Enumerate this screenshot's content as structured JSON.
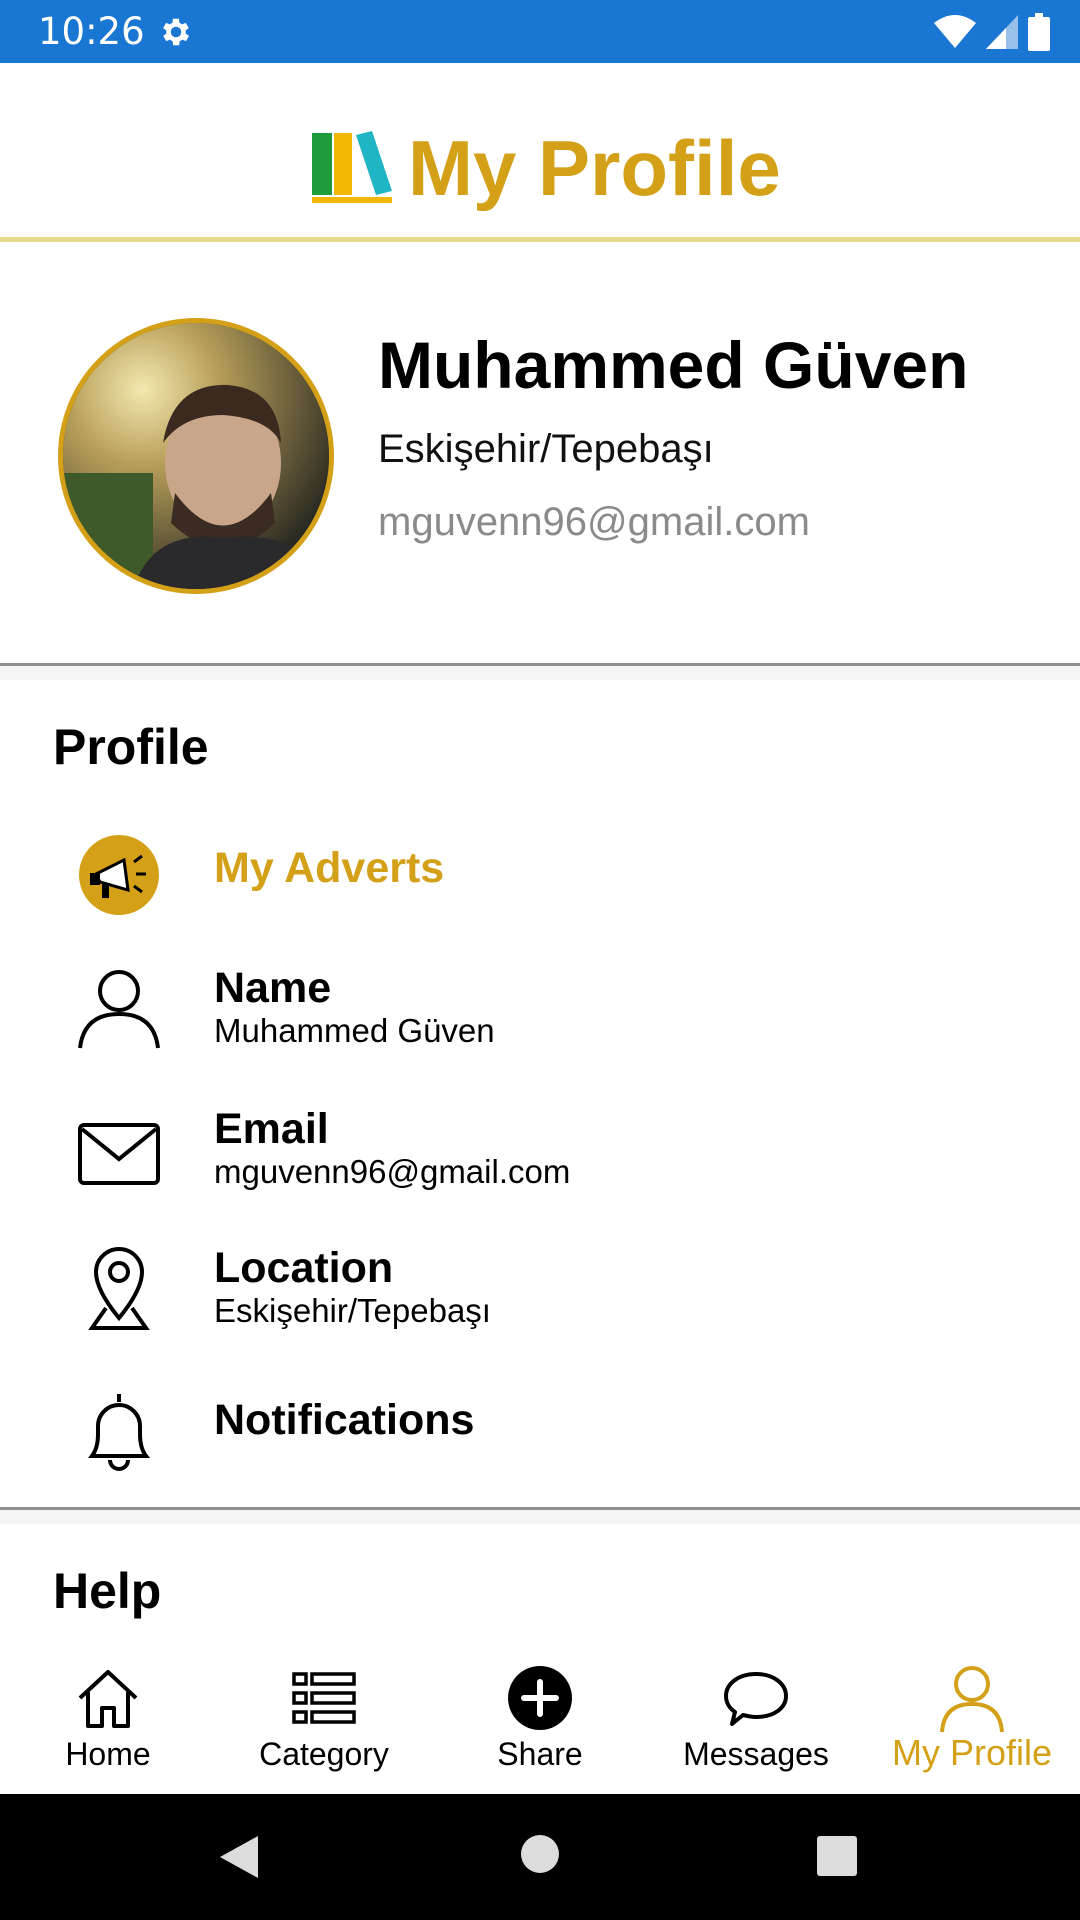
{
  "status_bar": {
    "time": "10:26"
  },
  "header": {
    "title": "My Profile"
  },
  "profile": {
    "name": "Muhammed Güven",
    "location": "Eskişehir/Tepebaşı",
    "email": "mguvenn96@gmail.com"
  },
  "sections": {
    "profile_title": "Profile",
    "help_title": "Help"
  },
  "rows": {
    "adverts": {
      "label": "My Adverts"
    },
    "name": {
      "label": "Name",
      "value": "Muhammed Güven"
    },
    "email": {
      "label": "Email",
      "value": "mguvenn96@gmail.com"
    },
    "location": {
      "label": "Location",
      "value": "Eskişehir/Tepebaşı"
    },
    "notifications": {
      "label": "Notifications"
    }
  },
  "bottom_nav": {
    "home": "Home",
    "category": "Category",
    "share": "Share",
    "messages": "Messages",
    "profile": "My Profile"
  },
  "colors": {
    "accent": "#D4A017",
    "status_bar": "#1976D2"
  },
  "icons": [
    "gear-icon",
    "wifi-icon",
    "signal-icon",
    "battery-icon",
    "books-logo-icon",
    "megaphone-icon",
    "person-icon",
    "mail-icon",
    "location-pin-icon",
    "bell-icon",
    "home-icon",
    "category-icon",
    "plus-circle-icon",
    "chat-icon",
    "back-icon",
    "home-circle-icon",
    "recents-icon"
  ]
}
